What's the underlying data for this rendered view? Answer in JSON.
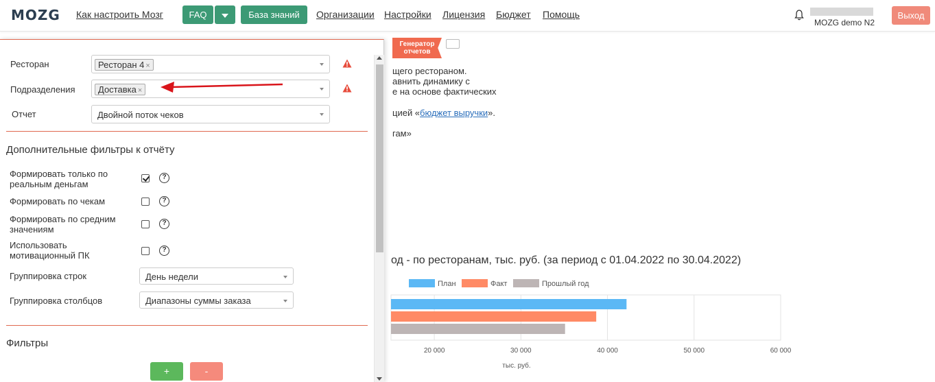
{
  "header": {
    "logo": "MOZG",
    "nav": {
      "how_to": "Как настроить Мозг",
      "faq": "FAQ",
      "knowledge": "База знаний",
      "orgs": "Организации",
      "settings": "Настройки",
      "license": "Лицензия",
      "budget": "Бюджет",
      "help": "Помощь"
    },
    "user": "MOZG demo N2",
    "logout": "Выход"
  },
  "background": {
    "badge": "Генератор отчетов",
    "line1": "щего ресторанoм.",
    "line2": "авнить динамику с",
    "line3": "е на основе фактических",
    "line4_prefix": "цией «",
    "line4_link": "бюджет выручки",
    "line4_suffix": "».",
    "line5": "гам»",
    "chart_title": "од - по ресторанам, тыс. руб. (за период с 01.04.2022 по 30.04.2022)"
  },
  "chart_data": {
    "type": "bar",
    "orientation": "horizontal",
    "categories": [
      ""
    ],
    "series": [
      {
        "name": "План",
        "values": [
          42200
        ],
        "color": "#5bb8f5"
      },
      {
        "name": "Факт",
        "values": [
          38700
        ],
        "color": "#ff8a65"
      },
      {
        "name": "Прошлый год",
        "values": [
          35100
        ],
        "color": "#bdb5b5"
      }
    ],
    "xlabel": "тыс. руб.",
    "xticks": [
      "20 000",
      "30 000",
      "40 000",
      "50 000",
      "60 000"
    ],
    "xlim": [
      15000,
      60000
    ],
    "legend": "top"
  },
  "panel": {
    "restaurant_label": "Ресторан",
    "restaurant_tag": "Ресторан 4",
    "division_label": "Подразделения",
    "division_tag": "Доставка",
    "report_label": "Отчет",
    "report_value": "Двойной поток чеков",
    "extra_filters_title": "Дополнительные фильтры к отчёту",
    "opt1": "Формировать только по реальным деньгам",
    "opt2": "Формировать по чекам",
    "opt3": "Формировать по средним значениям",
    "opt4": "Использовать мотивационный ПК",
    "row_group_label": "Группировка строк",
    "row_group_value": "День недели",
    "col_group_label": "Группировка столбцов",
    "col_group_value": "Диапазоны суммы заказа",
    "filters_title": "Фильтры",
    "plus": "+",
    "minus": "-",
    "tag_remove": "×",
    "help_glyph": "?"
  },
  "colors": {
    "accent_green": "#3c9a75",
    "logout_red": "#f08a7a",
    "divider": "#e0684f",
    "warning": "#e74c3c"
  }
}
